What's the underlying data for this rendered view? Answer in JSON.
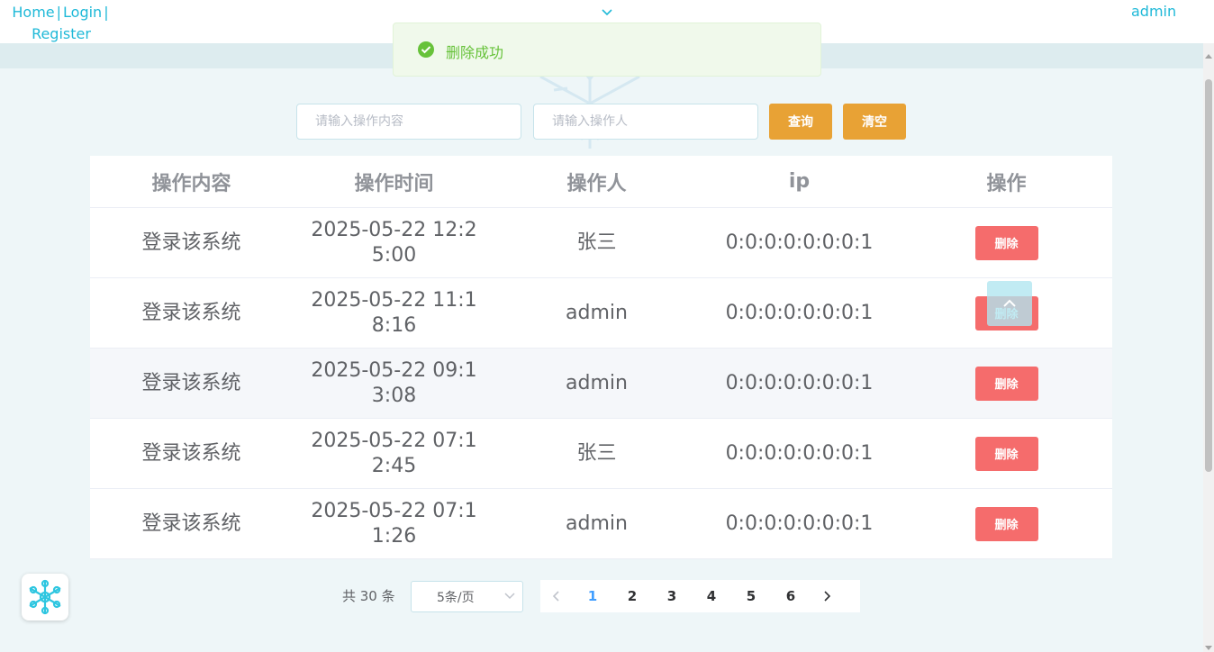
{
  "header": {
    "nav": {
      "home": "Home",
      "login": "Login",
      "register": "Register",
      "separator": "|"
    },
    "user": "admin"
  },
  "toast": {
    "message": "删除成功",
    "type": "success",
    "color": "#67c23a"
  },
  "search": {
    "content_placeholder": "请输入操作内容",
    "operator_placeholder": "请输入操作人",
    "query_label": "查询",
    "clear_label": "清空"
  },
  "table": {
    "headers": [
      "操作内容",
      "操作时间",
      "操作人",
      "ip",
      "操作"
    ],
    "rows": [
      {
        "content": "登录该系统",
        "time": "2025-05-22 12:25:00",
        "operator": "张三",
        "ip": "0:0:0:0:0:0:0:1",
        "action": "删除"
      },
      {
        "content": "登录该系统",
        "time": "2025-05-22 11:18:16",
        "operator": "admin",
        "ip": "0:0:0:0:0:0:0:1",
        "action": "删除"
      },
      {
        "content": "登录该系统",
        "time": "2025-05-22 09:13:08",
        "operator": "admin",
        "ip": "0:0:0:0:0:0:0:1",
        "action": "删除"
      },
      {
        "content": "登录该系统",
        "time": "2025-05-22 07:12:45",
        "operator": "张三",
        "ip": "0:0:0:0:0:0:0:1",
        "action": "删除"
      },
      {
        "content": "登录该系统",
        "time": "2025-05-22 07:11:26",
        "operator": "admin",
        "ip": "0:0:0:0:0:0:0:1",
        "action": "删除"
      }
    ]
  },
  "pagination": {
    "total": "共 30 条",
    "page_size": "5条/页",
    "pages": [
      "1",
      "2",
      "3",
      "4",
      "5",
      "6"
    ],
    "current_page": "1"
  },
  "colors": {
    "accent": "#1fb9d8",
    "query_button": "#e8a235",
    "delete_button": "#f56c6c",
    "active_page": "#409eff"
  },
  "icons": [
    "chevron-down-icon",
    "check-circle-icon",
    "chevron-up-icon",
    "chevron-left-icon",
    "chevron-right-icon",
    "snowflake-icon"
  ]
}
